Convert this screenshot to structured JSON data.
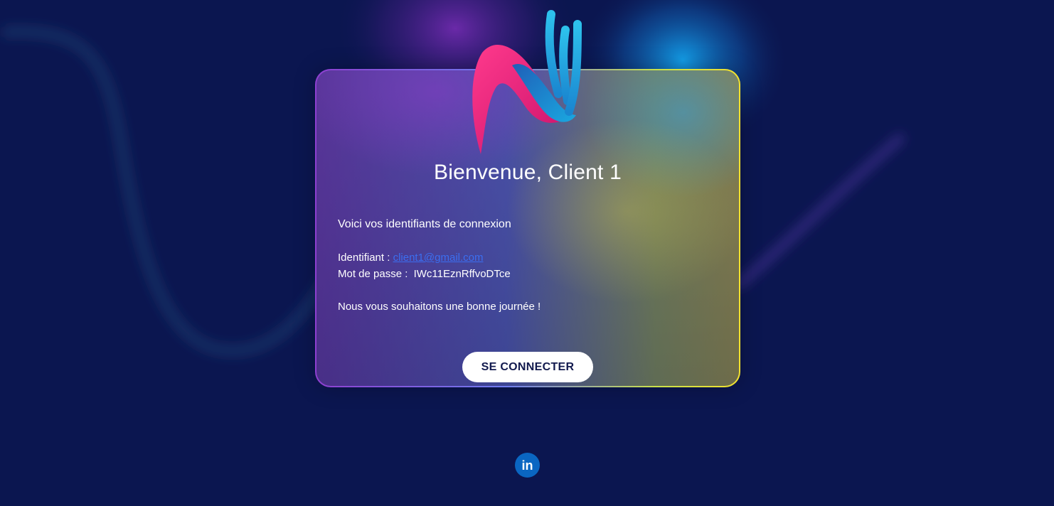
{
  "card": {
    "title": "Bienvenue, Client 1",
    "intro": "Voici vos identifiants de connexion",
    "identifier_label": "Identifiant : ",
    "identifier_value": "client1@gmail.com",
    "password_label": "Mot de passe : ",
    "password_value": "IWc11EznRffvoDTce",
    "closing": "Nous vous souhaitons une bonne journée !",
    "connect_button": "SE CONNECTER"
  },
  "footer": {
    "social_icon": "linkedin-icon",
    "social_text": "in"
  },
  "colors": {
    "background": "#0b1650",
    "button_bg": "#ffffff",
    "button_text": "#121a4e",
    "link": "#3b6ef0",
    "linkedin": "#0a66c2",
    "logo_pink": "#e8217a",
    "logo_blue": "#1eb0e0"
  },
  "icons": {
    "brand_logo": "brand-logo-icon"
  }
}
